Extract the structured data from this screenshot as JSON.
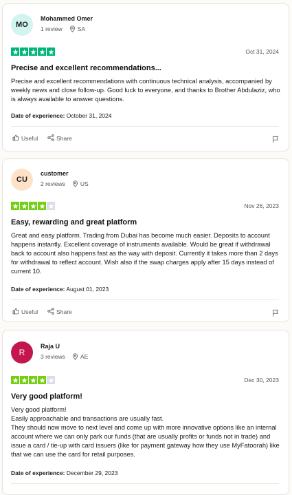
{
  "colors": {
    "star_green": "#00b67a",
    "star_lightgreen": "#73cf11",
    "star_empty": "#dcdce6",
    "avatar_mo_bg": "#d2f3ef",
    "avatar_cu_bg": "#fde2c7",
    "avatar_r_bg": "#c3164f"
  },
  "reviews": [
    {
      "avatar": "MO",
      "name": "Mohammed Omer",
      "count": "1 review",
      "country": "SA",
      "rating": 5,
      "date": "Oct 31, 2024",
      "title": "Precise and excellent recommendations...",
      "body": [
        "Precise and excellent recommendations with continuous technical analysis, accompanied by weekly news and close follow-up. Good luck to everyone, and thanks to Brother Abdulaziz, who is always available to answer questions."
      ],
      "experience_label": "Date of experience:",
      "experience_date": "October 31, 2024",
      "useful_label": "Useful",
      "share_label": "Share"
    },
    {
      "avatar": "CU",
      "name": "customer",
      "count": "2 reviews",
      "country": "US",
      "rating": 4,
      "date": "Nov 26, 2023",
      "title": "Easy, rewarding and great platform",
      "body": [
        "Great and easy platform. Trading from Dubai has become much easier. Deposits to account happens instantly. Excellent coverage of instruments available. Would be great if withdrawal back to account also happens fast as the way with deposit. Currently it takes more than 2 days for withdrawal to reflect account. Wish also if the swap charges apply after 15 days instead of current 10."
      ],
      "experience_label": "Date of experience:",
      "experience_date": "August 01, 2023",
      "useful_label": "Useful",
      "share_label": "Share"
    },
    {
      "avatar": "R",
      "name": "Raja U",
      "count": "3 reviews",
      "country": "AE",
      "rating": 4,
      "date": "Dec 30, 2023",
      "title": "Very good platform!",
      "body": [
        "Very good platform!",
        "Easily approachable and transactions are usually fast.",
        "They should now move to next level and come up with more innovative options like an internal account where we can only park our funds (that are usually profits or funds not in trade) and issue a card / tie-up with card issuers (like for payment gateway how they use MyFatoorah) like that we can use the card for retail purposes."
      ],
      "experience_label": "Date of experience:",
      "experience_date": "December 29, 2023",
      "useful_label": "Useful",
      "share_label": "Share"
    }
  ]
}
